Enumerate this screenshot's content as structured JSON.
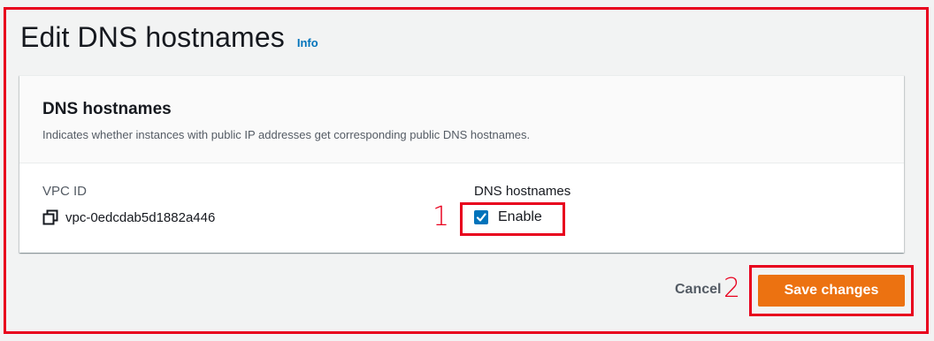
{
  "page": {
    "title": "Edit DNS hostnames",
    "info_link": "Info"
  },
  "card": {
    "title": "DNS hostnames",
    "description": "Indicates whether instances with public IP addresses get corresponding public DNS hostnames."
  },
  "fields": {
    "vpc_id_label": "VPC ID",
    "vpc_id_value": "vpc-0edcdab5d1882a446",
    "dns_hostnames_label": "DNS hostnames",
    "enable_checkbox_label": "Enable",
    "enable_checked": true
  },
  "actions": {
    "cancel_label": "Cancel",
    "save_label": "Save changes"
  },
  "annotations": {
    "marker_1": "1",
    "marker_2": "2"
  },
  "icons": {
    "copy": "copy-icon",
    "checkmark": "checkmark-icon"
  },
  "colors": {
    "accent_orange": "#ec7211",
    "link_blue": "#0073bb",
    "checkbox_blue": "#0073bb",
    "highlight_red": "#e8001d",
    "page_background": "#f2f3f3"
  }
}
